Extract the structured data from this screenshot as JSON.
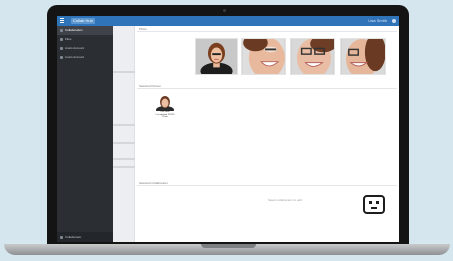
{
  "app": {
    "brand": "Collab Hub",
    "user_label": "Lisa Smith"
  },
  "sidebar": {
    "items": [
      {
        "label": "Collaboration"
      },
      {
        "label": "Files"
      },
      {
        "label": "Lisa's Account"
      },
      {
        "label": "Lisa's Account"
      }
    ],
    "footer_label": "Collaborator"
  },
  "main": {
    "photos_heading": "Photo",
    "people_heading": "Selected Person",
    "person_card": {
      "name": "Lisa Smith",
      "meta": "Last updated 3/21/23",
      "sub": "Photo"
    },
    "collab_heading": "Selected Collaborator",
    "empty_text": "Select collaborator to add"
  },
  "colors": {
    "accent": "#2f73b8",
    "sidebar_bg": "#2b2e33",
    "page_bg": "#d6e6ef"
  },
  "icons": [
    "menu-icon",
    "user-icon",
    "robot-icon"
  ]
}
